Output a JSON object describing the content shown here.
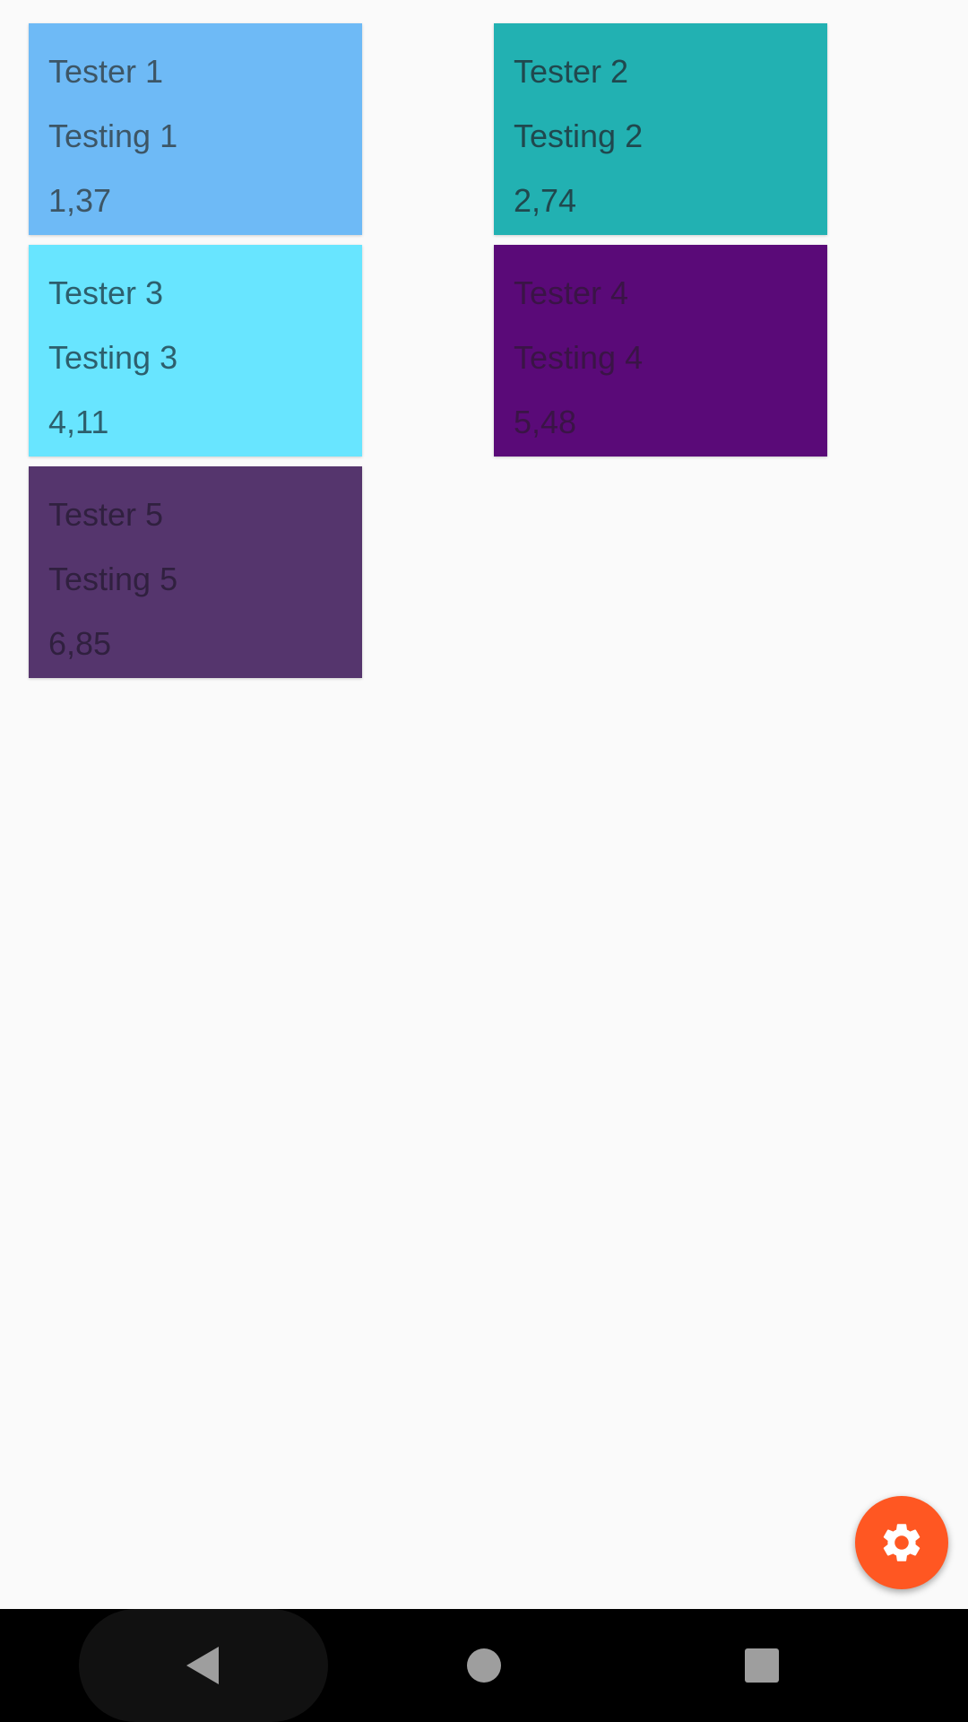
{
  "cards": [
    {
      "name": "Tester 1",
      "subtitle": "Testing 1",
      "value": "1,37",
      "bg": "#6EBAF6",
      "fg": "#3D5666"
    },
    {
      "name": "Tester 2",
      "subtitle": "Testing 2",
      "value": "2,74",
      "bg": "#22B1B2",
      "fg": "#20484E"
    },
    {
      "name": "Tester 3",
      "subtitle": "Testing 3",
      "value": "4,11",
      "bg": "#68E5FF",
      "fg": "#2D5F6D"
    },
    {
      "name": "Tester 4",
      "subtitle": "Testing 4",
      "value": "5,48",
      "bg": "#5A0A78",
      "fg": "#3A1446"
    },
    {
      "name": "Tester 5",
      "subtitle": "Testing 5",
      "value": "6,85",
      "bg": "#55356D",
      "fg": "#30203F"
    }
  ],
  "fab": {
    "icon": "gear-icon",
    "color": "#FF5722"
  },
  "navbar": {
    "back_icon": "back-triangle-icon",
    "home_icon": "home-circle-icon",
    "recents_icon": "recents-square-icon",
    "icon_color": "#9E9E9E"
  }
}
